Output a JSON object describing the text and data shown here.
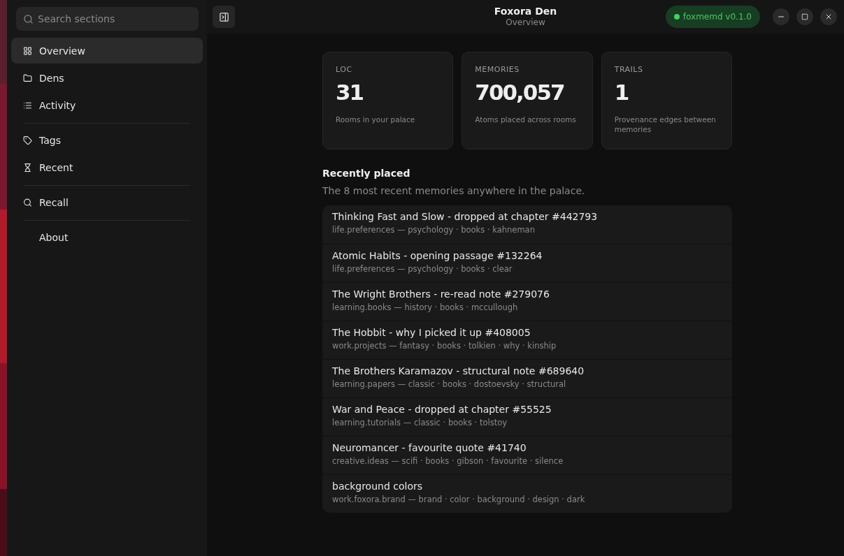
{
  "window": {
    "title": "Foxora Den",
    "subtitle": "Overview"
  },
  "sidebar": {
    "search": {
      "placeholder": "Search sections"
    },
    "groups": [
      {
        "items": [
          {
            "label": "Overview",
            "kind": "grid",
            "selected": true
          },
          {
            "label": "Dens",
            "kind": "folder",
            "selected": false
          },
          {
            "label": "Activity",
            "kind": "list",
            "selected": false
          }
        ]
      },
      {
        "items": [
          {
            "label": "Tags",
            "kind": "tag",
            "selected": false
          },
          {
            "label": "Recent",
            "kind": "hourglass",
            "selected": false
          }
        ]
      },
      {
        "items": [
          {
            "label": "Recall",
            "kind": "search",
            "selected": false
          }
        ]
      },
      {
        "items": [
          {
            "label": "About",
            "kind": "plain",
            "selected": false
          }
        ]
      }
    ]
  },
  "status_badge": {
    "label": "foxmemd v0.1.0",
    "online": true
  },
  "stats": [
    {
      "label": "LOC",
      "value": "31",
      "caption": "Rooms in your palace"
    },
    {
      "label": "MEMORIES",
      "value": "700,057",
      "caption": "Atoms placed across rooms"
    },
    {
      "label": "TRAILS",
      "value": "1",
      "caption": "Provenance edges between memories"
    }
  ],
  "recent": {
    "title": "Recently placed",
    "subtitle": "The 8 most recent memories anywhere in the palace.",
    "items": [
      {
        "title": "Thinking Fast and Slow - dropped at chapter #442793",
        "meta": "life.preferences — psychology · books · kahneman"
      },
      {
        "title": "Atomic Habits - opening passage #132264",
        "meta": "life.preferences — psychology · books · clear"
      },
      {
        "title": "The Wright Brothers - re-read note #279076",
        "meta": "learning.books — history · books · mccullough"
      },
      {
        "title": "The Hobbit - why I picked it up #408005",
        "meta": "work.projects — fantasy · books · tolkien · why · kinship"
      },
      {
        "title": "The Brothers Karamazov - structural note #689640",
        "meta": "learning.papers — classic · books · dostoevsky · structural"
      },
      {
        "title": "War and Peace - dropped at chapter #55525",
        "meta": "learning.tutorials — classic · books · tolstoy"
      },
      {
        "title": "Neuromancer - favourite quote #41740",
        "meta": "creative.ideas — scifi · books · gibson · favourite · silence"
      },
      {
        "title": "background colors",
        "meta": "work.foxora.brand — brand · color · background · design · dark"
      }
    ]
  }
}
